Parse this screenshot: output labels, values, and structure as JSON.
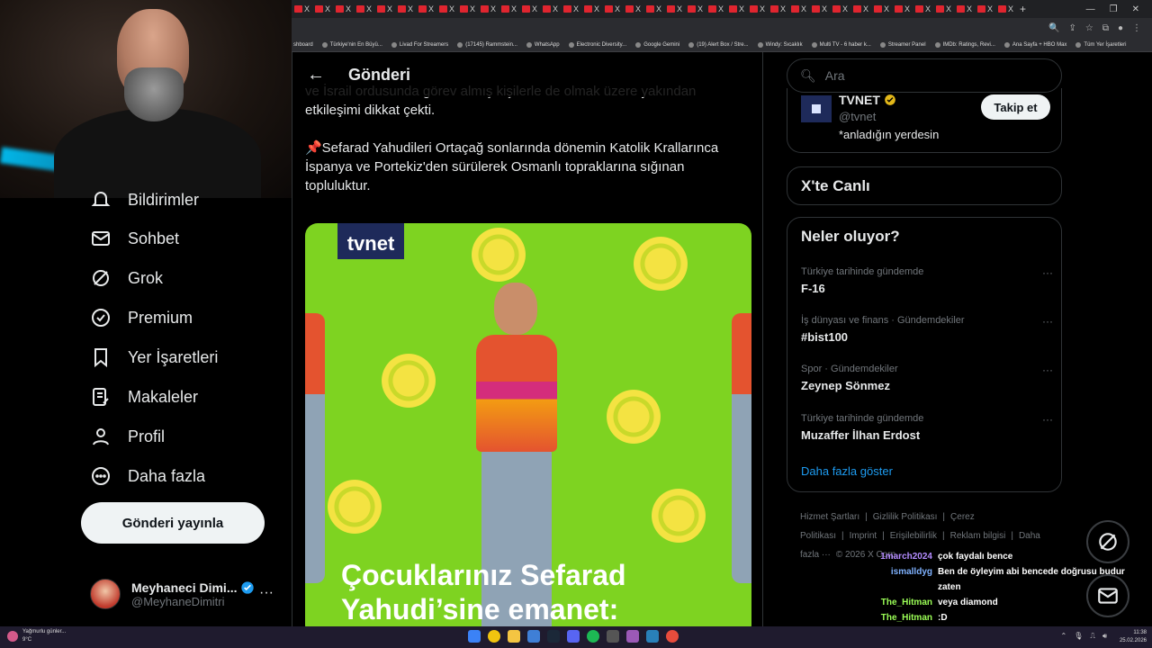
{
  "browser": {
    "tab_close": "X",
    "new_tab": "+",
    "bookmarks": [
      "shboard",
      "Türkiye'nin En Büyü...",
      "Livad For Streamers",
      "(17145) Rammstein...",
      "WhatsApp",
      "Electronic Diversity...",
      "Google Gemini",
      "(19) Alert Box / Stre...",
      "Windy: Sıcaklık",
      "Multi TV - 6 haber k...",
      "Streamer Panel",
      "IMDb: Ratings, Revi...",
      "Ana Sayfa + HBO Max",
      "Tüm Yer İşaretleri"
    ]
  },
  "nav": {
    "items": [
      {
        "label": "Bildirimler",
        "icon": "bell-icon"
      },
      {
        "label": "Sohbet",
        "icon": "mail-icon"
      },
      {
        "label": "Grok",
        "icon": "grok-icon"
      },
      {
        "label": "Premium",
        "icon": "premium-check-icon"
      },
      {
        "label": "Yer İşaretleri",
        "icon": "bookmark-icon"
      },
      {
        "label": "Makaleler",
        "icon": "articles-icon"
      },
      {
        "label": "Profil",
        "icon": "person-icon"
      },
      {
        "label": "Daha fazla",
        "icon": "more-circle-icon"
      }
    ],
    "post_button": "Gönderi yayınla",
    "account": {
      "name": "Meyhaneci Dimi...",
      "handle": "@MeyhaneDimitri",
      "more": "···"
    }
  },
  "main": {
    "header_title": "Gönderi",
    "paragraphs": [
      "ve İsrail ordusunda görev almış kişilerle de olmak üzere yakından etkileşimi dikkat çekti.",
      "📌Sefarad Yahudileri Ortaçağ sonlarında dönemin Katolik Krallarınca İspanya ve Portekiz'den sürülerek Osmanlı topraklarına sığınan topluluktur."
    ],
    "media": {
      "logo": "tvnet",
      "caption": "Çocuklarınız Sefarad Yahudi’sine emanet:"
    }
  },
  "right": {
    "search_placeholder": "Ara",
    "who_to_follow": {
      "name": "TVNET",
      "handle": "@tvnet",
      "bio": "*anladığın yerdesin",
      "follow_label": "Takip et"
    },
    "live_title": "X'te Canlı",
    "trends_title": "Neler oluyor?",
    "trends": [
      {
        "context": "Türkiye tarihinde gündemde",
        "name": "F-16"
      },
      {
        "context": "İş dünyası ve finans · Gündemdekiler",
        "name": "#bist100"
      },
      {
        "context": "Spor · Gündemdekiler",
        "name": "Zeynep Sönmez"
      },
      {
        "context": "Türkiye tarihinde gündemde",
        "name": "Muzaffer İlhan Erdost"
      }
    ],
    "trend_more": "···",
    "show_more": "Daha fazla göster",
    "footer": [
      "Hizmet Şartları",
      "|",
      "Gizlilik Politikası",
      "|",
      "Çerez Politikası",
      "|",
      "Imprint",
      "|",
      "Erişilebilirlik",
      "|",
      "Reklam bilgisi",
      "|",
      "Daha fazla ···",
      "© 2026 X Corp."
    ]
  },
  "chat": [
    {
      "user": "1march2024",
      "color": "#b48cff",
      "msg": "çok faydalı bence"
    },
    {
      "user": "ismalldyg",
      "color": "#7fb2ff",
      "msg": "Ben de öyleyim abi bencede doğrusu budur zaten"
    },
    {
      "user": "The_Hitman",
      "color": "#9cff57",
      "msg": "veya diamond"
    },
    {
      "user": "The_Hitman",
      "color": "#9cff57",
      "msg": ":D"
    },
    {
      "user": "ismalldyg",
      "color": "#7fb2ff",
      "msg": "😊"
    }
  ],
  "taskbar": {
    "weather": "Yağmurlu günler...",
    "temp": "9°C",
    "time": "11:38",
    "date": "25.02.2026"
  }
}
